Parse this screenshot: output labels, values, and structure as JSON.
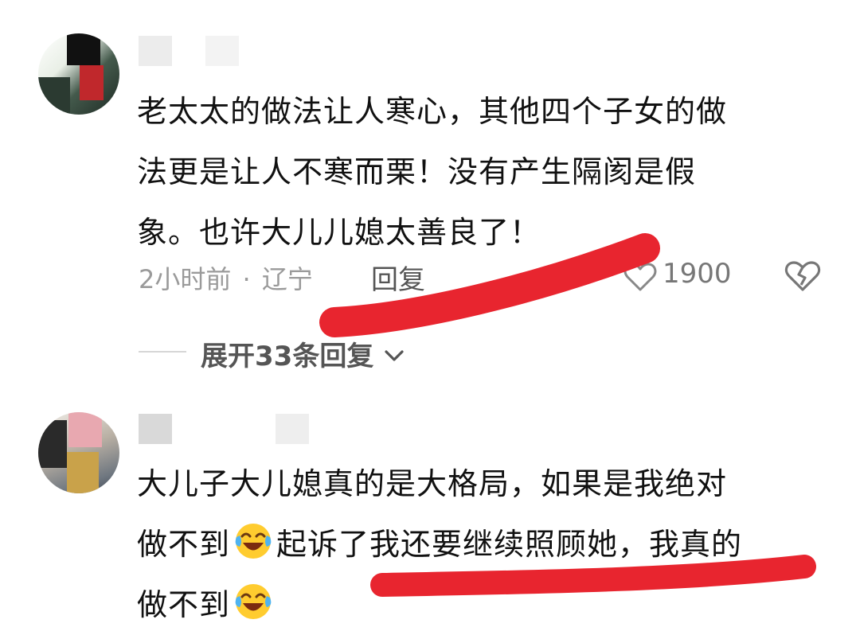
{
  "comments": [
    {
      "text_lines": [
        "老太太的做法让人寒心，其他四个子女的做",
        "法更是让人不寒而栗！没有产生隔阂是假",
        "象。也许大儿儿媳太善良了！"
      ],
      "time": "2小时前",
      "separator": "·",
      "location": "辽宁",
      "reply_label": "回复",
      "likes": "1900",
      "expand_label": "展开33条回复",
      "expand_icon": "chevron-down-icon"
    },
    {
      "line1": "大儿子大儿媳真的是大格局，如果是我绝对",
      "line2_a": "做不到",
      "line2_b": "起诉了我还要继续照顾她，我真的",
      "line3": "做不到",
      "emoji": "laughing-crying-emoji"
    }
  ],
  "colors": {
    "highlight_stroke": "#e8252f",
    "meta_text": "#9a9a9a"
  }
}
